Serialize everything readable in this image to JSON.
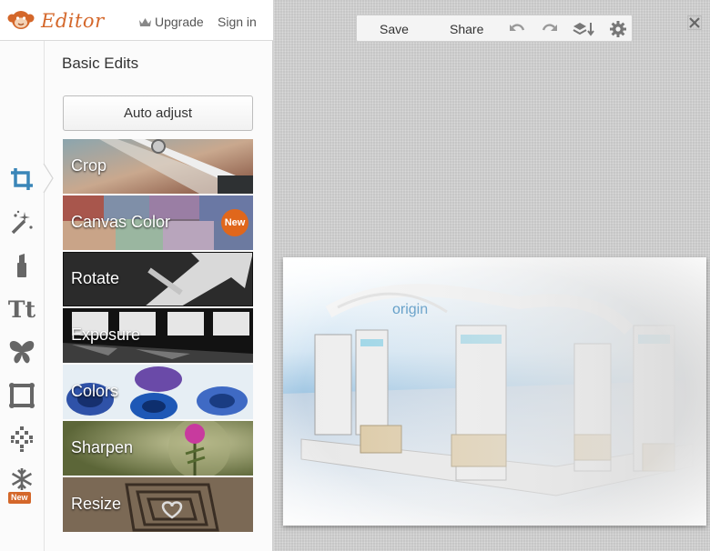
{
  "app": {
    "title": "Editor"
  },
  "header": {
    "upgrade_label": "Upgrade",
    "signin_label": "Sign in"
  },
  "tool_rail": {
    "items": [
      {
        "name": "crop-tool-icon",
        "active": true
      },
      {
        "name": "magic-wand-icon"
      },
      {
        "name": "lipstick-icon"
      },
      {
        "name": "text-icon",
        "label": "Tt"
      },
      {
        "name": "butterfly-icon"
      },
      {
        "name": "frame-icon"
      },
      {
        "name": "texture-icon"
      },
      {
        "name": "snowflake-icon",
        "badge": "New"
      }
    ]
  },
  "panel": {
    "section_title": "Basic Edits",
    "auto_adjust_label": "Auto adjust",
    "edits": [
      {
        "label": "Crop"
      },
      {
        "label": "Canvas Color",
        "badge": "New"
      },
      {
        "label": "Rotate"
      },
      {
        "label": "Exposure"
      },
      {
        "label": "Colors"
      },
      {
        "label": "Sharpen"
      },
      {
        "label": "Resize"
      }
    ]
  },
  "toolbar": {
    "save_label": "Save",
    "share_label": "Share",
    "icons": [
      "undo-icon",
      "redo-icon",
      "layers-icon",
      "settings-icon"
    ]
  },
  "photo": {
    "sign_text": "origin"
  },
  "colors": {
    "accent": "#d4672a",
    "badge": "#e0671c",
    "sky": "#6fa9d6"
  }
}
